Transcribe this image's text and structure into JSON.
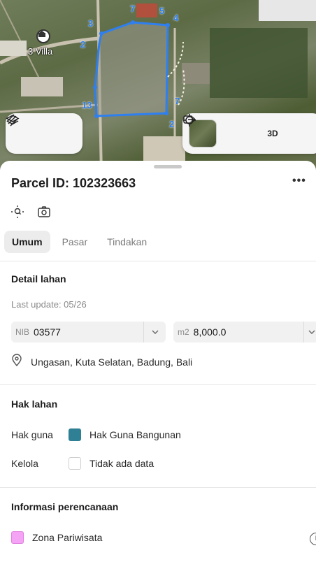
{
  "map": {
    "place_label": "3 Villa",
    "plot_numbers": [
      "7",
      "5",
      "4",
      "3",
      "2",
      "13",
      "7",
      "2"
    ],
    "controls": {
      "layers_icon": "layers-icon",
      "route_icon": "route-icon",
      "satellite_thumbnail": "satellite-thumbnail",
      "locate_icon": "crosshair-icon",
      "three_d_label": "3D",
      "share_icon": "share-icon"
    }
  },
  "sheet": {
    "title": "Parcel ID: 102323663",
    "more_label": "•••",
    "close_label": "✕",
    "tabs": [
      {
        "label": "Umum",
        "active": true
      },
      {
        "label": "Pasar",
        "active": false
      },
      {
        "label": "Tindakan",
        "active": false
      }
    ],
    "detail": {
      "title": "Detail lahan",
      "last_update": "Last update: 05/26",
      "nib_prefix": "NIB",
      "nib_value": "03577",
      "area_prefix": "m2",
      "area_value": "8,000.0",
      "location": "Ungasan, Kuta Selatan, Badung, Bali"
    },
    "rights": {
      "title": "Hak lahan",
      "rows": [
        {
          "label": "Hak guna",
          "value": "Hak Guna Bangunan",
          "color": "#2f7f95"
        },
        {
          "label": "Kelola",
          "value": "Tidak ada data",
          "color": "#ffffff"
        }
      ]
    },
    "planning": {
      "title": "Informasi perencanaan",
      "zone": "Zona Pariwisata",
      "zone_color": "#f5a3f5",
      "info_label": "i"
    }
  }
}
